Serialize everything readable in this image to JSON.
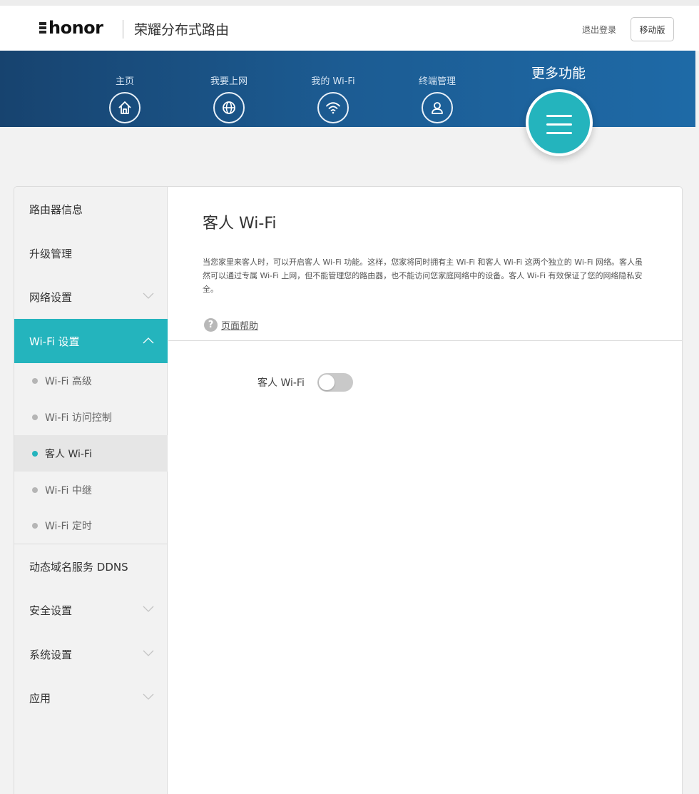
{
  "header": {
    "brand_mark": "荣耀",
    "logo": "honor",
    "product_name": "荣耀分布式路由",
    "logout_label": "退出登录",
    "mobile_label": "移动版"
  },
  "nav": {
    "items": [
      {
        "label": "主页",
        "icon": "home-icon"
      },
      {
        "label": "我要上网",
        "icon": "globe-icon"
      },
      {
        "label": "我的 Wi-Fi",
        "icon": "wifi-icon"
      },
      {
        "label": "终端管理",
        "icon": "user-icon"
      }
    ],
    "more_label": "更多功能",
    "more_icon": "menu-icon",
    "accent": "#24b4bd"
  },
  "sidebar": {
    "items": [
      {
        "label": "路由器信息"
      },
      {
        "label": "升级管理"
      },
      {
        "label": "网络设置",
        "expandable": true
      },
      {
        "label": "Wi-Fi 设置",
        "expandable": true,
        "expanded": true
      },
      {
        "label": "动态域名服务 DDNS"
      },
      {
        "label": "安全设置",
        "expandable": true
      },
      {
        "label": "系统设置",
        "expandable": true
      },
      {
        "label": "应用",
        "expandable": true
      }
    ],
    "wifi_sub_items": [
      {
        "label": "Wi-Fi 高级"
      },
      {
        "label": "Wi-Fi 访问控制"
      },
      {
        "label": "客人 Wi-Fi",
        "active": true
      },
      {
        "label": "Wi-Fi 中继"
      },
      {
        "label": "Wi-Fi 定时"
      }
    ]
  },
  "content": {
    "title": "客人 Wi-Fi",
    "description": "当您家里来客人时，可以开启客人 Wi-Fi 功能。这样，您家将同时拥有主 Wi-Fi 和客人 Wi-Fi 这两个独立的 Wi-Fi 网络。客人虽然可以通过专属 Wi-Fi 上网，但不能管理您的路由器，也不能访问您家庭网络中的设备。客人 Wi-Fi 有效保证了您的网络隐私安全。",
    "help_icon": "?",
    "help_label": "页面帮助",
    "toggle_label": "客人 Wi-Fi",
    "toggle_on": false
  }
}
